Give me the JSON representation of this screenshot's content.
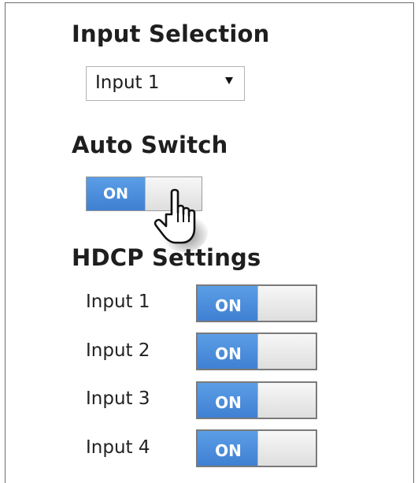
{
  "input_selection": {
    "heading": "Input Selection",
    "selected": "Input 1"
  },
  "auto_switch": {
    "heading": "Auto Switch",
    "state": "ON"
  },
  "hdcp": {
    "heading": "HDCP Settings",
    "inputs": [
      {
        "label": "Input 1",
        "state": "ON"
      },
      {
        "label": "Input 2",
        "state": "ON"
      },
      {
        "label": "Input 3",
        "state": "ON"
      },
      {
        "label": "Input 4",
        "state": "ON"
      }
    ]
  },
  "colors": {
    "toggle_on": "#4a8fe0",
    "toggle_off": "#e8e8e8"
  },
  "icons": {
    "pointer": "hand-pointer-icon"
  }
}
